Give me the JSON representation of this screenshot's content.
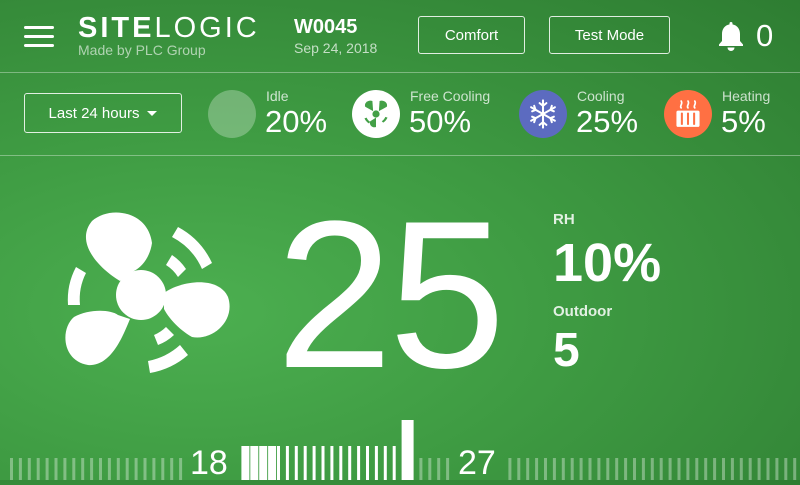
{
  "header": {
    "logo_bold": "SITE",
    "logo_light": "LOGIC",
    "maker": "Made by PLC Group",
    "site_id": "W0045",
    "date": "Sep 24, 2018",
    "comfort_label": "Comfort",
    "test_mode_label": "Test Mode",
    "notification_count": "0",
    "icons": [
      "menu-icon",
      "bell-icon"
    ]
  },
  "stats": {
    "range_label": "Last 24 hours",
    "modes": [
      {
        "label": "Idle",
        "percent": "20%",
        "icon": "idle-icon",
        "color": "#7cc27f"
      },
      {
        "label": "Free Cooling",
        "percent": "50%",
        "icon": "fan-icon",
        "color": "#ffffff"
      },
      {
        "label": "Cooling",
        "percent": "25%",
        "icon": "snowflake-icon",
        "color": "#5c6bc0"
      },
      {
        "label": "Heating",
        "percent": "5%",
        "icon": "heater-icon",
        "color": "#ff7043"
      }
    ]
  },
  "main": {
    "mode_icon": "fan-icon",
    "temperature": "25",
    "rh_label": "RH",
    "rh_value": "10%",
    "outdoor_label": "Outdoor",
    "outdoor_value": "5"
  },
  "setpoint_scale": {
    "low": "18",
    "high": "27",
    "current": "25"
  },
  "colors": {
    "background": "#3f9c43",
    "accent": "#ffffff"
  }
}
